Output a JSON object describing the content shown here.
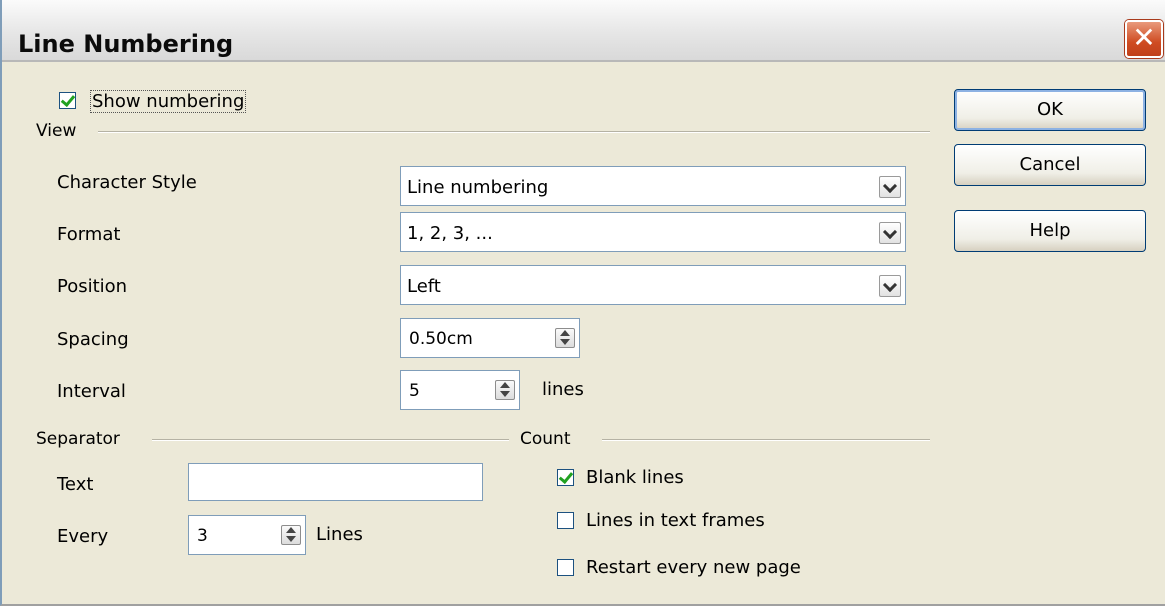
{
  "dialog": {
    "title": "Line Numbering",
    "close_symbol": "✕"
  },
  "show_numbering": {
    "label": "Show numbering",
    "checked": true
  },
  "view": {
    "group_title": "View",
    "character_style": {
      "label": "Character Style",
      "value": "Line numbering"
    },
    "format": {
      "label": "Format",
      "value": "1, 2, 3, ..."
    },
    "position": {
      "label": "Position",
      "value": "Left"
    },
    "spacing": {
      "label": "Spacing",
      "value": "0.50cm"
    },
    "interval": {
      "label": "Interval",
      "value": "5",
      "unit": "lines"
    }
  },
  "separator": {
    "group_title": "Separator",
    "text": {
      "label": "Text",
      "value": ""
    },
    "every": {
      "label": "Every",
      "value": "3",
      "unit": "Lines"
    }
  },
  "count": {
    "group_title": "Count",
    "blank_lines": {
      "label": "Blank lines",
      "checked": true
    },
    "lines_in_text_frames": {
      "label": "Lines in text frames",
      "checked": false
    },
    "restart_every_new_page": {
      "label": "Restart every new page",
      "checked": false
    }
  },
  "buttons": {
    "ok": "OK",
    "cancel": "Cancel",
    "help": "Help"
  },
  "icons": {
    "close": "close-icon",
    "dropdown": "chevron-down-icon",
    "spin": "spin-arrows-icon",
    "check": "checkmark-icon"
  }
}
